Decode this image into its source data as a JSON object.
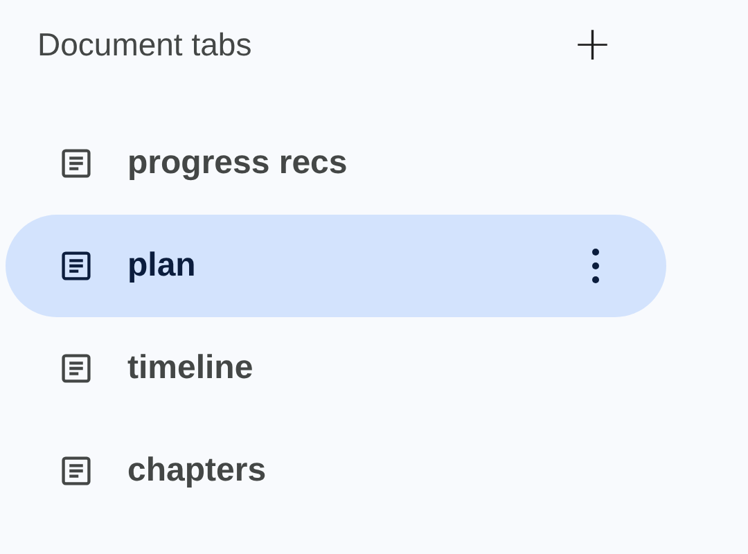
{
  "panel": {
    "title": "Document tabs",
    "add_label": "+"
  },
  "tabs": [
    {
      "label": "progress recs",
      "selected": false
    },
    {
      "label": "plan",
      "selected": true
    },
    {
      "label": "timeline",
      "selected": false
    },
    {
      "label": "chapters",
      "selected": false
    }
  ]
}
